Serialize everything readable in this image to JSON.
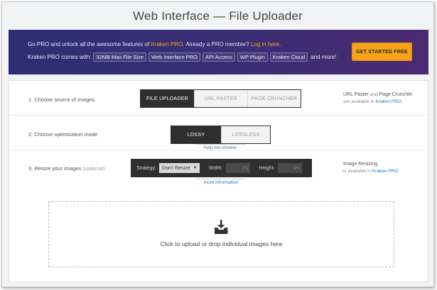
{
  "page": {
    "title": "Web Interface — File Uploader"
  },
  "promo": {
    "line1_a": "Go PRO and unlock all the awesome features of ",
    "line1_link1": "Kraken PRO",
    "line1_b": ". Already a PRO member? ",
    "line1_link2": "Log in here",
    "line1_c": ".",
    "line2_lead": "Kraken PRO comes with:",
    "features": [
      "32MB Max File Size",
      "Web Interface PRO",
      "API Access",
      "WP Plugin",
      "Kraken Cloud"
    ],
    "line2_tail": "and more!",
    "cta_label": "GET STARTED FREE"
  },
  "source": {
    "label": "1. Choose source of images",
    "tabs": [
      "FILE UPLOADER",
      "URL PASTER",
      "PAGE CRUNCHER"
    ],
    "side_a": "URL Paster",
    "side_b": " and ",
    "side_c": "Page Cruncher",
    "side_d": "are available in ",
    "side_link": "Kraken PRO"
  },
  "optimization": {
    "label": "2. Choose optimization mode",
    "modes": [
      "LOSSY",
      "LOSSLESS"
    ],
    "help": "help me choose"
  },
  "resize": {
    "label": "3. Resize your images",
    "optional": "(optional)",
    "strategy_label": "Strategy:",
    "strategy_value": "Don't Resize",
    "width_label": "Width:",
    "height_label": "Height:",
    "px_unit": "PX",
    "help": "more information",
    "side_title": "Image Resizing",
    "side_d": "is available in ",
    "side_link": "Kraken PRO"
  },
  "upload": {
    "text": "Click to upload or drop individual images here"
  },
  "colors": {
    "accent": "#f6a21a",
    "promo_bg": "#2d2e73",
    "link": "#2a7ab8"
  },
  "icons": {
    "upload": "upload-tray-icon",
    "dropdown": "caret-down-icon"
  }
}
